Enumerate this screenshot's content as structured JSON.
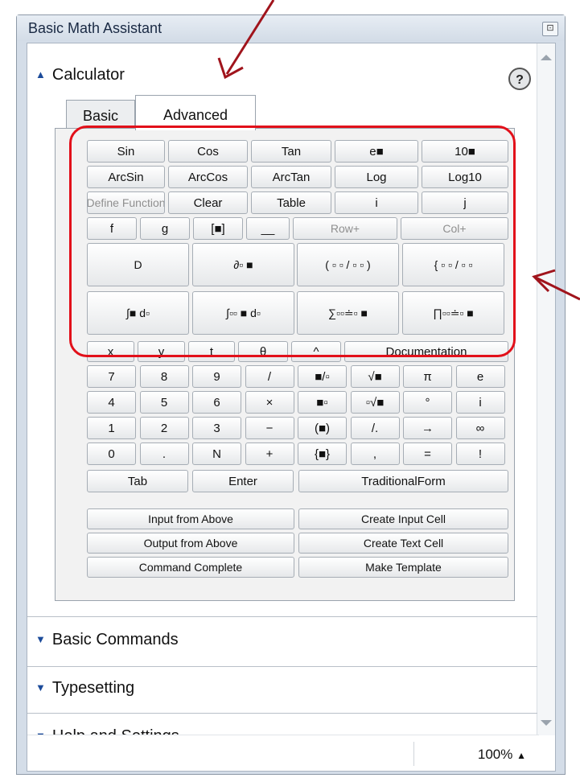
{
  "window": {
    "title": "Basic Math Assistant",
    "close_icon": "close-icon"
  },
  "calculator": {
    "section_label": "Calculator",
    "help_label": "?",
    "tabs": [
      "Basic",
      "Advanced"
    ],
    "advanced_rows": [
      [
        "Sin",
        "Cos",
        "Tan",
        "e■",
        "10■"
      ],
      [
        "ArcSin",
        "ArcCos",
        "ArcTan",
        "Log",
        "Log10"
      ],
      [
        "Define Function",
        "Clear",
        "Table",
        "i",
        "j"
      ],
      [
        "f",
        "g",
        "[■]",
        "__",
        "Row+",
        "Col+"
      ],
      [
        "D",
        "∂▫ ■",
        "( ▫ ▫ / ▫ ▫ )",
        "{ ▫ ▫ / ▫ ▫"
      ],
      [
        "∫■ d▫",
        "∫▫▫ ■ d▫",
        "∑▫▫≐▫ ■",
        "∏▫▫≐▫ ■"
      ]
    ],
    "var_row": [
      "x",
      "y",
      "t",
      "θ",
      "^",
      "Documentation"
    ],
    "keypad_rows": [
      [
        "7",
        "8",
        "9",
        "/",
        "■/▫",
        "√■",
        "π",
        "e"
      ],
      [
        "4",
        "5",
        "6",
        "×",
        "■▫",
        "▫√■",
        "°",
        "i"
      ],
      [
        "1",
        "2",
        "3",
        "−",
        "(■)",
        "/.",
        "→",
        "∞"
      ],
      [
        "0",
        ".",
        "N",
        "+",
        "{■}",
        ",",
        "=",
        "!"
      ]
    ],
    "action_row": [
      "Tab",
      "Enter",
      "TraditionalForm"
    ],
    "cell_buttons": [
      [
        "Input from Above",
        "Create Input Cell"
      ],
      [
        "Output from Above",
        "Create Text Cell"
      ],
      [
        "Command Complete",
        "Make Template"
      ]
    ]
  },
  "sections": [
    "Basic Commands",
    "Typesetting",
    "Help and Settings"
  ],
  "zoom_label": "100%",
  "colors": {
    "highlight": "#e2101a",
    "arrow": "#a0141c",
    "chevron": "#1c4b9a"
  }
}
